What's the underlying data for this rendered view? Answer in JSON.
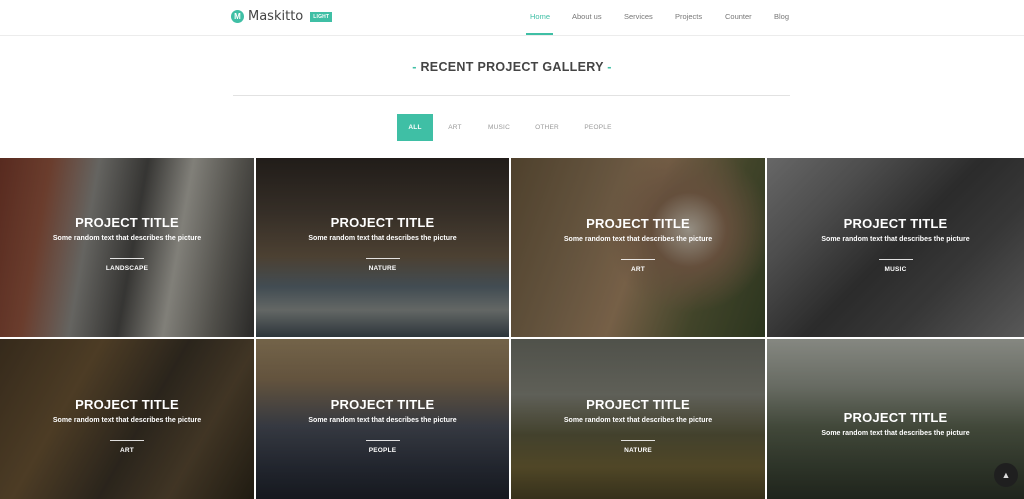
{
  "brand": {
    "logo_letter": "M",
    "name": "Maskitto",
    "badge": "LIGHT"
  },
  "nav": {
    "items": [
      {
        "label": "Home",
        "active": true
      },
      {
        "label": "About us"
      },
      {
        "label": "Services"
      },
      {
        "label": "Projects"
      },
      {
        "label": "Counter"
      },
      {
        "label": "Blog"
      }
    ]
  },
  "section": {
    "dash_left": "-",
    "title": "RECENT PROJECT GALLERY",
    "dash_right": "-"
  },
  "filters": [
    {
      "label": "ALL",
      "active": true
    },
    {
      "label": "ART"
    },
    {
      "label": "MUSIC"
    },
    {
      "label": "OTHER"
    },
    {
      "label": "PEOPLE"
    }
  ],
  "projects": [
    {
      "title": "PROJECT TITLE",
      "description": "Some random text that describes the picture",
      "category": "LANDSCAPE"
    },
    {
      "title": "PROJECT TITLE",
      "description": "Some random text that describes the picture",
      "category": "NATURE"
    },
    {
      "title": "PROJECT TITLE",
      "description": "Some random text that describes the picture",
      "category": "ART"
    },
    {
      "title": "PROJECT TITLE",
      "description": "Some random text that describes the picture",
      "category": "MUSIC"
    },
    {
      "title": "PROJECT TITLE",
      "description": "Some random text that describes the picture",
      "category": "ART"
    },
    {
      "title": "PROJECT TITLE",
      "description": "Some random text that describes the picture",
      "category": "PEOPLE"
    },
    {
      "title": "PROJECT TITLE",
      "description": "Some random text that describes the picture",
      "category": "NATURE"
    },
    {
      "title": "PROJECT TITLE",
      "description": "Some random text that describes the picture",
      "category": ""
    }
  ],
  "scroll_top_icon": "chevron-up-icon",
  "colors": {
    "accent": "#3fbfa5"
  }
}
